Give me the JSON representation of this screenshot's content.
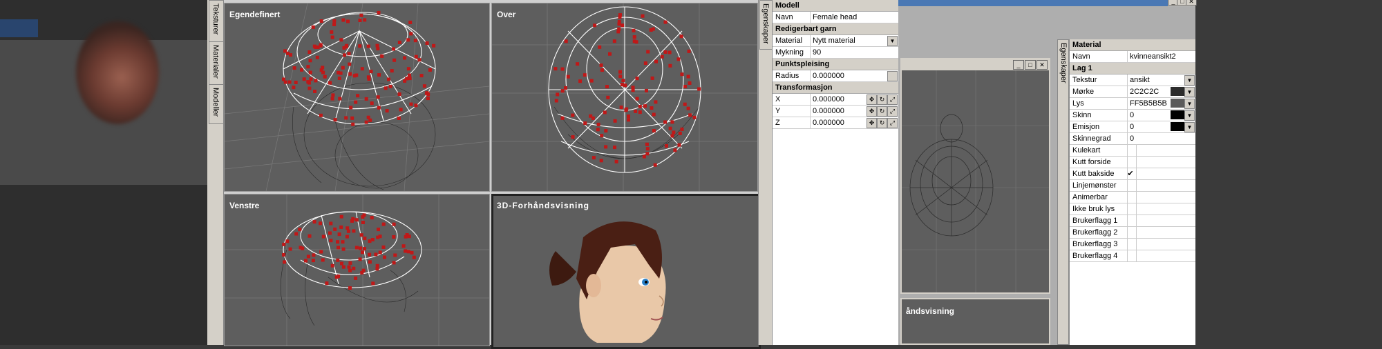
{
  "tabs_left": [
    "Teksturer",
    "Materialer",
    "Modeller"
  ],
  "viewports": {
    "custom": "Egendefinert",
    "top": "Over",
    "left": "Venstre",
    "preview": "3D-Forhåndsvisning"
  },
  "props_tab": "Egenskaper",
  "props": {
    "model_section": "Modell",
    "name_label": "Navn",
    "name_value": "Female head",
    "editable_section": "Redigerbart garn",
    "material_label": "Material",
    "material_value": "Nytt material",
    "smoothing_label": "Mykning",
    "smoothing_value": "90",
    "point_section": "Punktspleising",
    "radius_label": "Radius",
    "radius_value": "0.000000",
    "transform_section": "Transformasjon",
    "x_label": "X",
    "x_value": "0.000000",
    "y_label": "Y",
    "y_value": "0.000000",
    "z_label": "Z",
    "z_value": "0.000000"
  },
  "window2": {
    "preview_partial": "åndsvisning"
  },
  "material_tab": "Egenskaper",
  "material": {
    "section": "Material",
    "name_label": "Navn",
    "name_value": "kvinneansikt2",
    "layer_section": "Lag 1",
    "texture_label": "Tekstur",
    "texture_value": "ansikt",
    "dark_label": "Mørke",
    "dark_value": "2C2C2C",
    "light_label": "Lys",
    "light_value": "FF5B5B5B",
    "shine_label": "Skinn",
    "shine_value": "0",
    "emission_label": "Emisjon",
    "emission_value": "0",
    "shine_degree_label": "Skinnegrad",
    "shine_degree_value": "0",
    "flags": [
      {
        "label": "Kulekart",
        "checked": ""
      },
      {
        "label": "Kutt forside",
        "checked": ""
      },
      {
        "label": "Kutt bakside",
        "checked": "✔"
      },
      {
        "label": "Linjemønster",
        "checked": ""
      },
      {
        "label": "Animerbar",
        "checked": ""
      },
      {
        "label": "Ikke bruk lys",
        "checked": ""
      },
      {
        "label": "Brukerflagg 1",
        "checked": ""
      },
      {
        "label": "Brukerflagg 2",
        "checked": ""
      },
      {
        "label": "Brukerflagg 3",
        "checked": ""
      },
      {
        "label": "Brukerflagg 4",
        "checked": ""
      }
    ],
    "colors": {
      "dark": "#2c2c2c",
      "light": "#5b5b5b",
      "shine": "#000000",
      "emission": "#000000"
    }
  },
  "icons": {
    "dropdown": "▼",
    "move": "✥",
    "rotate": "↻",
    "scale": "⤢",
    "minimize": "_",
    "maximize": "□",
    "close": "✕"
  }
}
